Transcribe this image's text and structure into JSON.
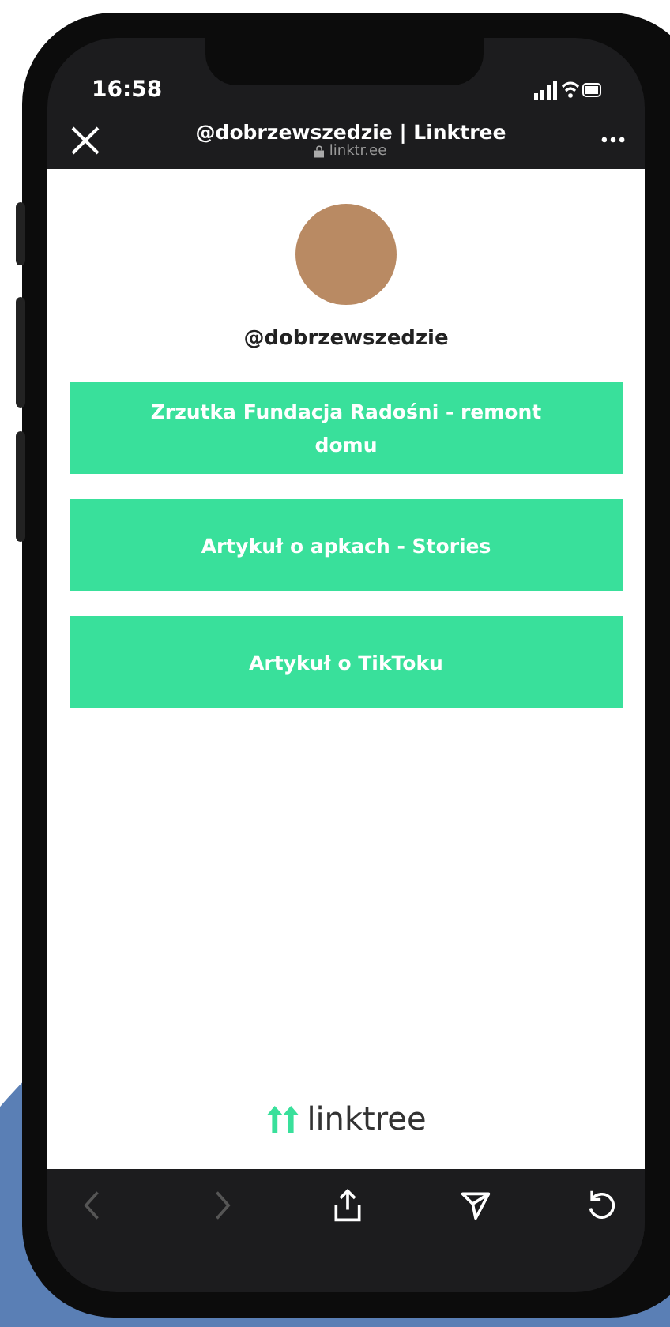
{
  "status_bar": {
    "time": "16:58"
  },
  "browser_header": {
    "title": "@dobrzewszedzie | Linktree",
    "url": "linktr.ee"
  },
  "profile": {
    "username": "@dobrzewszedzie"
  },
  "links": [
    {
      "label": "Zrzutka Fundacja Radośni - remont domu"
    },
    {
      "label": "Artykuł o apkach - Stories"
    },
    {
      "label": "Artykuł o TikToku"
    }
  ],
  "footer": {
    "brand": "linktree"
  },
  "toolbar": [
    {
      "kind": "back",
      "disabled": true
    },
    {
      "kind": "forward",
      "disabled": true
    },
    {
      "kind": "share",
      "disabled": false
    },
    {
      "kind": "send",
      "disabled": false
    },
    {
      "kind": "reload",
      "disabled": false
    }
  ]
}
